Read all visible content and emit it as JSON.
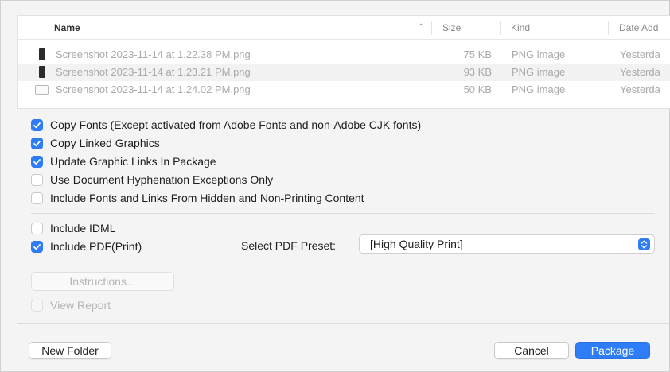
{
  "file_list": {
    "columns": {
      "name": "Name",
      "size": "Size",
      "kind": "Kind",
      "date": "Date Add"
    },
    "rows": [
      {
        "name": "Screenshot 2023-11-14 at 1.22.38 PM.png",
        "size": "75 KB",
        "kind": "PNG image",
        "date": "Yesterda",
        "thumb": "portrait-dark"
      },
      {
        "name": "Screenshot 2023-11-14 at 1.23.21 PM.png",
        "size": "93 KB",
        "kind": "PNG image",
        "date": "Yesterda",
        "thumb": "portrait-dark"
      },
      {
        "name": "Screenshot 2023-11-14 at 1.24.02 PM.png",
        "size": "50 KB",
        "kind": "PNG image",
        "date": "Yesterda",
        "thumb": "landscape-light"
      }
    ]
  },
  "options": {
    "copy_fonts": {
      "label": "Copy Fonts (Except activated from Adobe Fonts and non-Adobe CJK fonts)",
      "checked": true
    },
    "copy_linked_graphics": {
      "label": "Copy Linked Graphics",
      "checked": true
    },
    "update_graphic_links": {
      "label": "Update Graphic Links In Package",
      "checked": true
    },
    "hyphenation_exceptions": {
      "label": "Use Document Hyphenation Exceptions Only",
      "checked": false
    },
    "include_hidden": {
      "label": "Include Fonts and Links From Hidden and Non-Printing Content",
      "checked": false
    },
    "include_idml": {
      "label": "Include IDML",
      "checked": false
    },
    "include_pdf": {
      "label": "Include PDF(Print)",
      "checked": true
    }
  },
  "pdf_preset": {
    "label": "Select PDF Preset:",
    "value": "[High Quality Print]"
  },
  "instructions_button": "Instructions...",
  "view_report": {
    "label": "View Report",
    "checked": false,
    "disabled": true
  },
  "buttons": {
    "new_folder": "New Folder",
    "cancel": "Cancel",
    "package": "Package"
  },
  "colors": {
    "accent": "#2f7df6",
    "dim_text": "#a9a9a9",
    "background": "#f4f4f4"
  }
}
